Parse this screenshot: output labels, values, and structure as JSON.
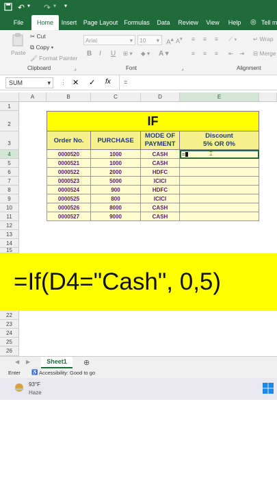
{
  "tabs": [
    "File",
    "Home",
    "Insert",
    "Page Layout",
    "Formulas",
    "Data",
    "Review",
    "View",
    "Help",
    "Tell me"
  ],
  "ribbon": {
    "cut": "Cut",
    "copy": "Copy",
    "format_painter": "Format Painter",
    "paste": "Paste",
    "font_name": "Arial",
    "font_size": "10",
    "bold": "B",
    "italic": "I",
    "underline": "U",
    "wrap": "Wrap",
    "merge": "Merge",
    "groups": {
      "clipboard": "Clipboard",
      "font": "Font",
      "alignment": "Alignment"
    }
  },
  "formula_bar": {
    "name_box": "SUM",
    "fx": "fx",
    "content": "="
  },
  "columns": [
    "A",
    "B",
    "C",
    "D",
    "E"
  ],
  "rows": [
    "1",
    "2",
    "3",
    "4",
    "5",
    "6",
    "7",
    "8",
    "9",
    "10",
    "11",
    "12",
    "13",
    "14",
    "15"
  ],
  "rows_bottom": [
    "22",
    "23",
    "24",
    "25",
    "26"
  ],
  "table": {
    "title": "IF",
    "headers": [
      "Order No.",
      "PURCHASE",
      "MODE OF\nPAYMENT",
      "Discount\n5% OR 0%"
    ],
    "data": [
      [
        "0000520",
        "1000",
        "CASH"
      ],
      [
        "0000521",
        "1000",
        "CASH"
      ],
      [
        "0000522",
        "2000",
        "HDFC"
      ],
      [
        "0000523",
        "5000",
        "ICICI"
      ],
      [
        "0000524",
        "900",
        "HDFC"
      ],
      [
        "0000525",
        "800",
        "ICICI"
      ],
      [
        "0000526",
        "8000",
        "CASH"
      ],
      [
        "0000527",
        "9000",
        "CASH"
      ]
    ],
    "active_cell_text": "="
  },
  "banner_text": "=If(D4=\"Cash\", 0,5)",
  "sheet_tab": "Sheet1",
  "status": {
    "mode": "Enter",
    "accessibility": "Accessibility: Good to go"
  },
  "taskbar": {
    "temp": "93°F",
    "weather": "Haze"
  },
  "colors": {
    "excel_green": "#1f6b3a",
    "banner": "#ffff00",
    "title_fill": "#ffff00",
    "header_fill": "#f6f18c",
    "data_fill": "#fffdd0"
  }
}
